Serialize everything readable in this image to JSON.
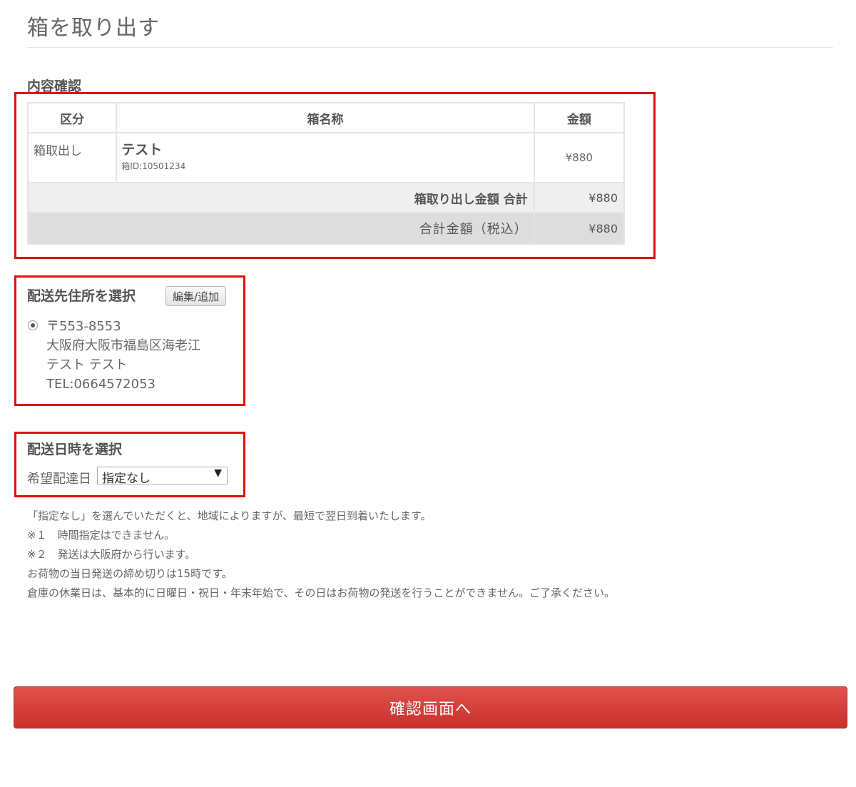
{
  "page": {
    "title": "箱を取り出す"
  },
  "content_check": {
    "heading": "内容確認",
    "columns": {
      "kubun": "区分",
      "name": "箱名称",
      "price": "金額"
    },
    "item": {
      "kubun": "箱取出し",
      "name": "テスト",
      "box_id": "箱ID:10501234",
      "price": "¥880"
    },
    "subtotal": {
      "label": "箱取り出し金額 合計",
      "value": "¥880"
    },
    "total": {
      "label": "合計金額（税込）",
      "value": "¥880"
    }
  },
  "address_section": {
    "heading": "配送先住所を選択",
    "edit_button_label": "編集/追加",
    "address": {
      "postal": "〒553-8553",
      "line1": "大阪府大阪市福島区海老江",
      "name": "テスト テスト",
      "tel": "TEL:0664572053"
    }
  },
  "date_section": {
    "heading": "配送日時を選択",
    "label": "希望配達日",
    "selected": "指定なし"
  },
  "notes": [
    "「指定なし」を選んでいただくと、地域によりますが、最短で翌日到着いたします。",
    "※１　時間指定はできません。",
    "※２　発送は大阪府から行います。",
    "お荷物の当日発送の締め切りは15時です。",
    "倉庫の休業日は、基本的に日曜日・祝日・年末年始で、その日はお荷物の発送を行うことができません。ご了承ください。"
  ],
  "confirm_button_label": "確認画面へ",
  "colors": {
    "highlight": "#e01010",
    "primary_button": "#d9433f"
  }
}
